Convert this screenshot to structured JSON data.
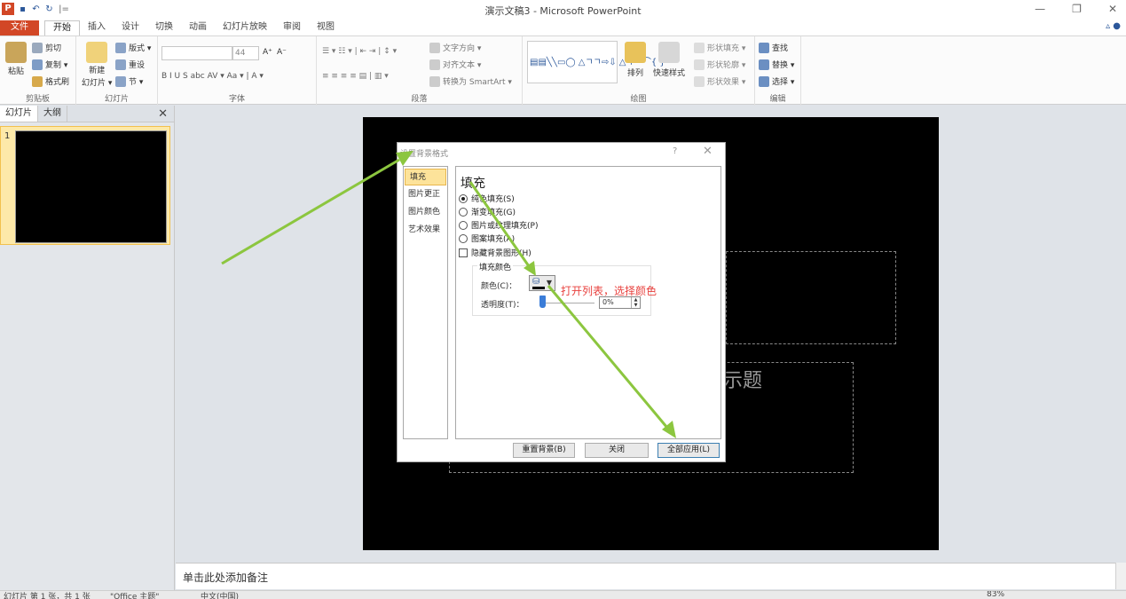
{
  "window": {
    "title": "演示文稿3 - Microsoft PowerPoint",
    "logo_letter": "P",
    "qat_sep": "|=",
    "minimize": "—",
    "restore": "❐",
    "close": "✕"
  },
  "tabs": [
    "文件",
    "开始",
    "插入",
    "设计",
    "切换",
    "动画",
    "幻灯片放映",
    "审阅",
    "视图"
  ],
  "active_tab": "开始",
  "ribbon": {
    "clipboard": {
      "label": "剪贴板",
      "paste": "粘贴",
      "cut": "剪切",
      "copy": "复制 ▾",
      "format_painter": "格式刷"
    },
    "slides": {
      "label": "幻灯片",
      "new_slide": "新建",
      "new_slide2": "幻灯片 ▾",
      "layout": "版式 ▾",
      "reset": "重设",
      "section": "节 ▾"
    },
    "font": {
      "label": "字体",
      "size": "44",
      "grow": "A⁺",
      "shrink": "A⁻",
      "row2": "B  I  U  S  abc  AV ▾  Aa ▾  |  A ▾"
    },
    "paragraph": {
      "label": "段落",
      "text_direction": "文字方向 ▾",
      "align_text": "对齐文本 ▾",
      "smartart": "转换为 SmartArt ▾"
    },
    "drawing": {
      "label": "绘图",
      "arrange": "排列",
      "quick_styles": "快速样式",
      "shape_fill": "形状填充 ▾",
      "shape_outline": "形状轮廓 ▾",
      "shape_effects": "形状效果 ▾"
    },
    "editing": {
      "label": "编辑",
      "find": "查找",
      "replace": "替换 ▾",
      "select": "选择 ▾"
    }
  },
  "pane": {
    "tab_slides": "幻灯片",
    "tab_outline": "大纲",
    "close": "✕",
    "slide_number": "1"
  },
  "slide": {
    "subtitle_fragment": "示题"
  },
  "notes": {
    "placeholder": "单击此处添加备注"
  },
  "status": {
    "slide_info": "幻灯片 第 1 张，共 1 张",
    "theme": "\"Office 主题\"",
    "language": "中文(中国)",
    "zoom": "83%"
  },
  "dialog": {
    "title": "设置背景格式",
    "help": "?",
    "close": "✕",
    "nav": [
      "填充",
      "图片更正",
      "图片颜色",
      "艺术效果"
    ],
    "selected_nav": "填充",
    "heading": "填充",
    "options": [
      {
        "label": "纯色填充(S)",
        "type": "radio",
        "checked": true
      },
      {
        "label": "渐变填充(G)",
        "type": "radio",
        "checked": false
      },
      {
        "label": "图片或纹理填充(P)",
        "type": "radio",
        "checked": false
      },
      {
        "label": "图案填充(A)",
        "type": "radio",
        "checked": false
      },
      {
        "label": "隐藏背景图形(H)",
        "type": "checkbox",
        "checked": false
      }
    ],
    "fill_color_group": "填充颜色",
    "color_label": "颜色(C)：",
    "transparency_label": "透明度(T)：",
    "transparency_value": "0%",
    "buttons": {
      "reset": "重置背景(B)",
      "close": "关闭",
      "apply_all": "全部应用(L)"
    }
  },
  "annotation": "打开列表，选择颜色",
  "colors": {
    "accent": "#d24726",
    "arrow": "#8cc63f",
    "annotation": "#e8423f"
  }
}
